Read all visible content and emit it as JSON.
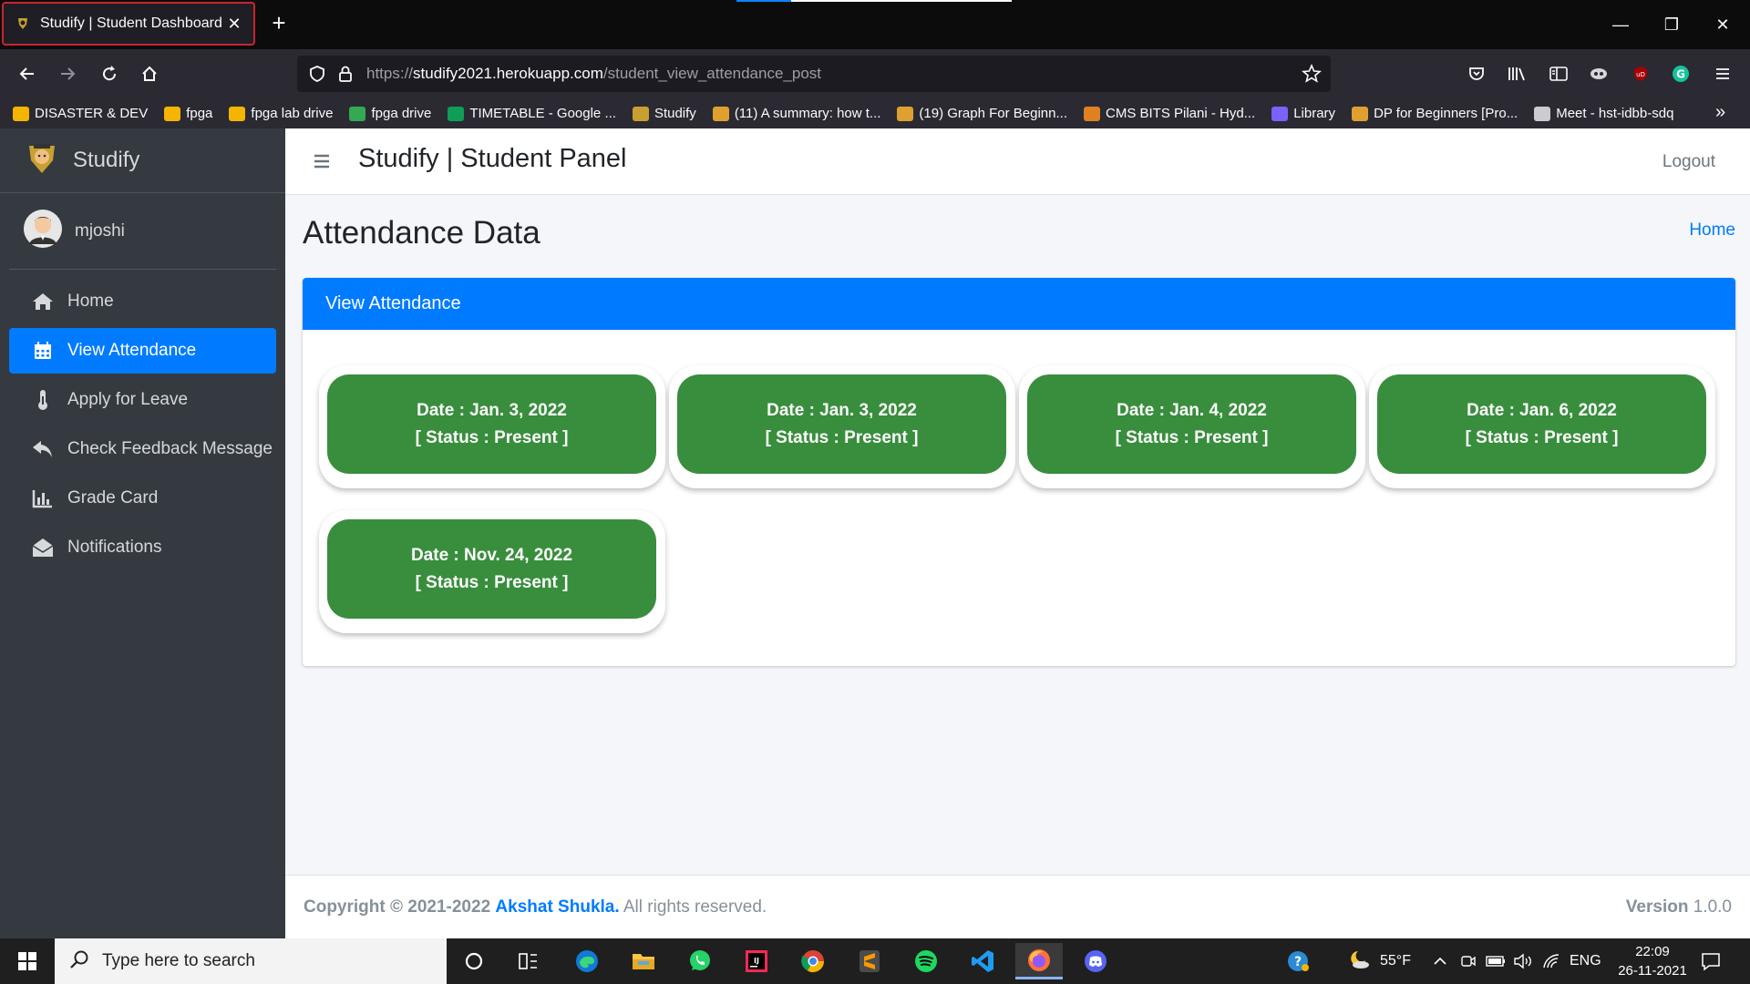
{
  "browser": {
    "tab_title": "Studify | Student Dashboard",
    "url_prefix": "https://",
    "url_host": "studify2021.herokuapp.com",
    "url_path": "/student_view_attendance_post",
    "bookmarks": [
      {
        "label": "DISASTER & DEV",
        "color": "#f4b400"
      },
      {
        "label": "fpga",
        "color": "#f4b400"
      },
      {
        "label": "fpga lab drive",
        "color": "#f4b400"
      },
      {
        "label": "fpga drive",
        "color": "#34a853"
      },
      {
        "label": "TIMETABLE - Google ...",
        "color": "#0f9d58"
      },
      {
        "label": "Studify",
        "color": "#c8a032"
      },
      {
        "label": "(11) A summary: how t...",
        "color": "#e0a030"
      },
      {
        "label": "(19) Graph For Beginn...",
        "color": "#e0a030"
      },
      {
        "label": "CMS BITS Pilani - Hyd...",
        "color": "#e08020"
      },
      {
        "label": "Library",
        "color": "#7b61ff"
      },
      {
        "label": "DP for Beginners [Pro...",
        "color": "#e0a030"
      },
      {
        "label": "Meet - hst-idbb-sdq",
        "color": "#cccccc"
      }
    ]
  },
  "sidebar": {
    "brand": "Studify",
    "username": "mjoshi",
    "items": [
      {
        "label": "Home",
        "icon": "home-icon"
      },
      {
        "label": "View Attendance",
        "icon": "calendar-icon"
      },
      {
        "label": "Apply for Leave",
        "icon": "thermometer-icon"
      },
      {
        "label": "Check Feedback Message",
        "icon": "reply-icon"
      },
      {
        "label": "Grade Card",
        "icon": "chart-icon"
      },
      {
        "label": "Notifications",
        "icon": "envelope-open-icon"
      }
    ]
  },
  "header": {
    "panel_title": "Studify | Student Panel",
    "logout": "Logout"
  },
  "page": {
    "title": "Attendance Data",
    "breadcrumb": "Home",
    "card_title": "View Attendance",
    "records": [
      {
        "date": "Date : Jan. 3, 2022",
        "status": "[ Status : Present ]"
      },
      {
        "date": "Date : Jan. 3, 2022",
        "status": "[ Status : Present ]"
      },
      {
        "date": "Date : Jan. 4, 2022",
        "status": "[ Status : Present ]"
      },
      {
        "date": "Date : Jan. 6, 2022",
        "status": "[ Status : Present ]"
      },
      {
        "date": "Date : Nov. 24, 2022",
        "status": "[ Status : Present ]"
      }
    ]
  },
  "footer": {
    "copyright": "Copyright © 2021-2022",
    "author": "Akshat Shukla.",
    "rights": "All rights reserved.",
    "version_label": "Version",
    "version": "1.0.0"
  },
  "taskbar": {
    "search_placeholder": "Type here to search",
    "weather": "55°F",
    "language": "ENG",
    "time": "22:09",
    "date": "26-11-2021"
  },
  "colors": {
    "primary": "#007bff",
    "sidebar": "#343a40",
    "present": "#388e3c"
  }
}
